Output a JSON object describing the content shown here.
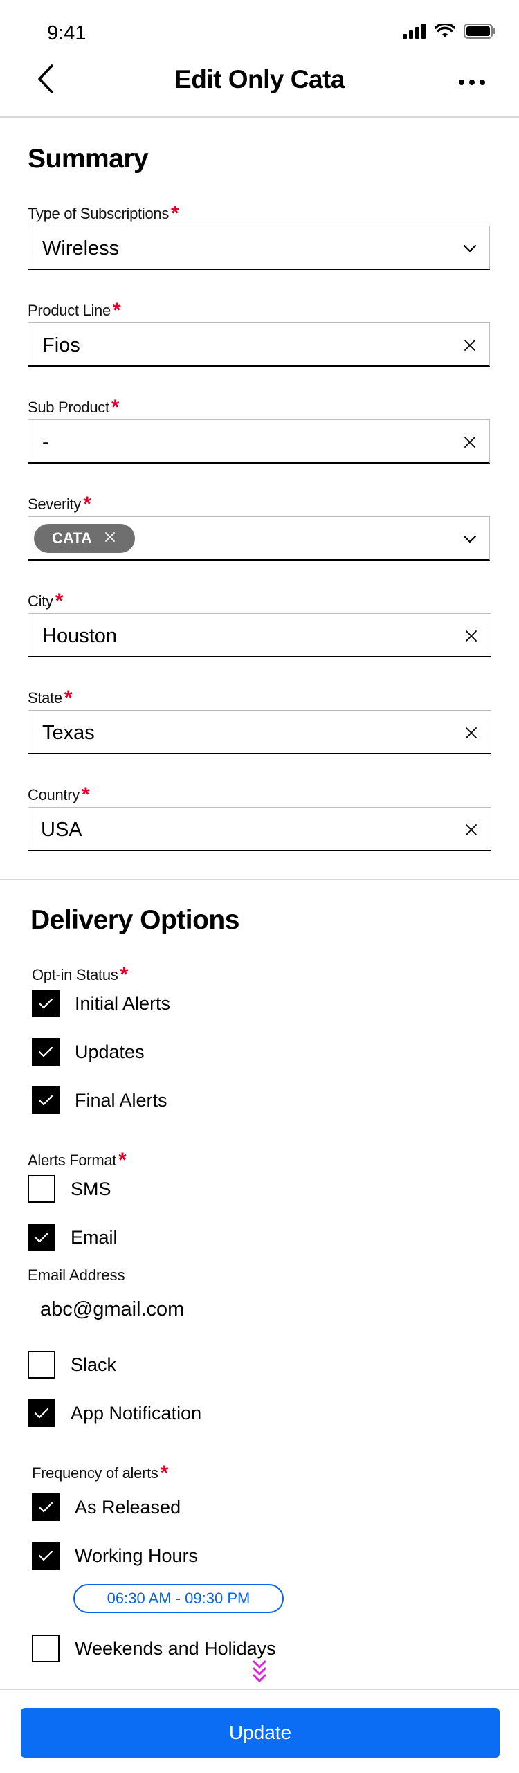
{
  "status_bar": {
    "time": "9:41"
  },
  "nav": {
    "title": "Edit Only Cata"
  },
  "summary": {
    "title": "Summary",
    "fields": {
      "subscription_type": {
        "label": "Type of Subscriptions",
        "value": "Wireless"
      },
      "product_line": {
        "label": "Product Line",
        "value": "Fios"
      },
      "sub_product": {
        "label": "Sub Product",
        "value": "-"
      },
      "severity": {
        "label": "Severity",
        "chip": "CATA"
      },
      "city": {
        "label": "City",
        "value": "Houston"
      },
      "state": {
        "label": "State",
        "value": "Texas"
      },
      "country": {
        "label": "Country",
        "value": "USA"
      }
    },
    "required_mark": "*"
  },
  "delivery": {
    "title": "Delivery Options",
    "opt_in": {
      "label": "Opt-in Status",
      "items": [
        {
          "label": "Initial Alerts",
          "checked": true
        },
        {
          "label": "Updates",
          "checked": true
        },
        {
          "label": "Final Alerts",
          "checked": true
        }
      ]
    },
    "alerts_format": {
      "label": "Alerts Format",
      "items": [
        {
          "label": "SMS",
          "checked": false
        },
        {
          "label": "Email",
          "checked": true
        },
        {
          "label": "Slack",
          "checked": false
        },
        {
          "label": "App Notification",
          "checked": true
        }
      ],
      "email_label": "Email Address",
      "email_value": "abc@gmail.com"
    },
    "frequency": {
      "label": "Frequency of alerts",
      "items": [
        {
          "label": "As Released",
          "checked": true
        },
        {
          "label": "Working Hours",
          "checked": true
        },
        {
          "label": "Weekends and Holidays",
          "checked": false
        }
      ],
      "working_hours_range": "06:30 AM - 09:30 PM"
    }
  },
  "footer": {
    "update_label": "Update"
  },
  "colors": {
    "accent": "#0b6cf4",
    "required": "#e0002a",
    "scroll_hint": "#e020e0"
  },
  "icons": [
    "signal-icon",
    "wifi-icon",
    "battery-icon",
    "back-arrow-icon",
    "more-icon",
    "chevron-down-icon",
    "clear-icon",
    "check-icon",
    "scroll-down-icon"
  ]
}
